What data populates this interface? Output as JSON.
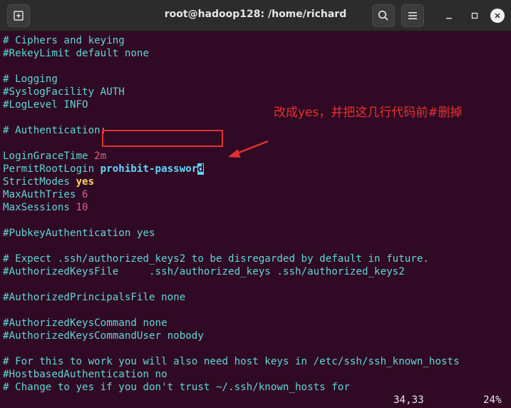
{
  "window": {
    "title": "root@hadoop128: /home/richard",
    "new_tab_icon": "new-tab-icon",
    "search_icon": "search-icon",
    "menu_icon": "hamburger-menu-icon",
    "minimize_icon": "minimize-icon",
    "maximize_icon": "maximize-icon",
    "close_icon": "close-icon"
  },
  "editor": {
    "lines": {
      "l1": "# Ciphers and keying",
      "l2": "#RekeyLimit default none",
      "l3": "# Logging",
      "l4": "#SyslogFacility AUTH",
      "l5": "#LogLevel INFO",
      "l6": "# Authentication:",
      "l7_key": "LoginGraceTime ",
      "l7_val": "2m",
      "l8_key": "PermitRootLogin ",
      "l8_val": "prohibit-passwor",
      "l8_cursor": "d",
      "l9_key": "StrictModes ",
      "l9_val": "yes",
      "l10_key": "MaxAuthTries ",
      "l10_val": "6",
      "l11_key": "MaxSessions ",
      "l11_val": "10",
      "l12": "#PubkeyAuthentication yes",
      "l13": "# Expect .ssh/authorized_keys2 to be disregarded by default in future.",
      "l14": "#AuthorizedKeysFile     .ssh/authorized_keys .ssh/authorized_keys2",
      "l15": "#AuthorizedPrincipalsFile none",
      "l16": "#AuthorizedKeysCommand none",
      "l17": "#AuthorizedKeysCommandUser nobody",
      "l18": "# For this to work you will also need host keys in /etc/ssh/ssh_known_hosts",
      "l19": "#HostbasedAuthentication no",
      "l20": "# Change to yes if you don't trust ~/.ssh/known_hosts for"
    },
    "status": {
      "position": "34,33",
      "percent": "24%"
    }
  },
  "annotation": {
    "text": "改成yes，并把这几行代码前#删掉",
    "color": "#e83030"
  },
  "colors": {
    "background": "#300a24",
    "comment": "#5fd7d7",
    "number": "#d75f87",
    "keyword_value": "#ffd75f"
  }
}
